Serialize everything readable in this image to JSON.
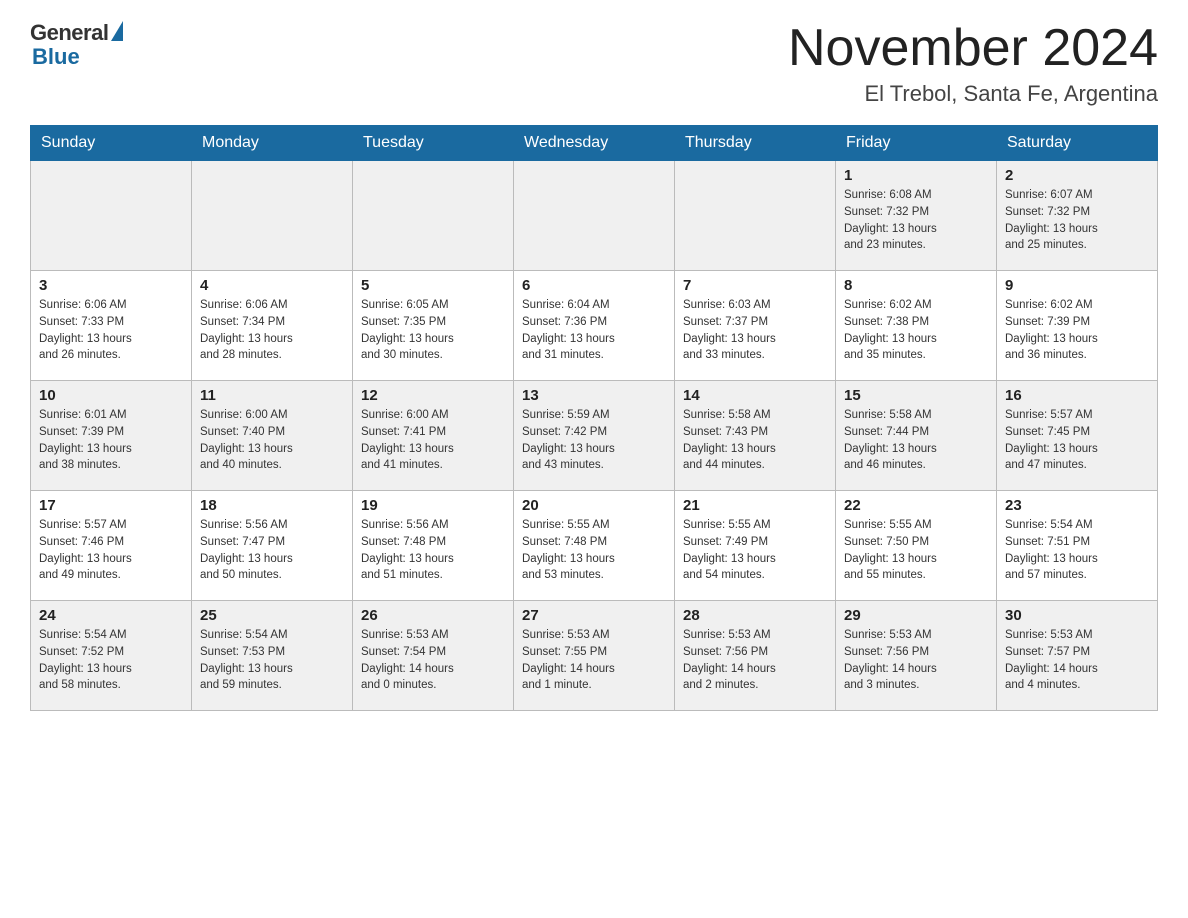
{
  "header": {
    "logo_general": "General",
    "logo_blue": "Blue",
    "month_title": "November 2024",
    "location": "El Trebol, Santa Fe, Argentina"
  },
  "weekdays": [
    "Sunday",
    "Monday",
    "Tuesday",
    "Wednesday",
    "Thursday",
    "Friday",
    "Saturday"
  ],
  "rows": [
    [
      {
        "day": "",
        "info": ""
      },
      {
        "day": "",
        "info": ""
      },
      {
        "day": "",
        "info": ""
      },
      {
        "day": "",
        "info": ""
      },
      {
        "day": "",
        "info": ""
      },
      {
        "day": "1",
        "info": "Sunrise: 6:08 AM\nSunset: 7:32 PM\nDaylight: 13 hours\nand 23 minutes."
      },
      {
        "day": "2",
        "info": "Sunrise: 6:07 AM\nSunset: 7:32 PM\nDaylight: 13 hours\nand 25 minutes."
      }
    ],
    [
      {
        "day": "3",
        "info": "Sunrise: 6:06 AM\nSunset: 7:33 PM\nDaylight: 13 hours\nand 26 minutes."
      },
      {
        "day": "4",
        "info": "Sunrise: 6:06 AM\nSunset: 7:34 PM\nDaylight: 13 hours\nand 28 minutes."
      },
      {
        "day": "5",
        "info": "Sunrise: 6:05 AM\nSunset: 7:35 PM\nDaylight: 13 hours\nand 30 minutes."
      },
      {
        "day": "6",
        "info": "Sunrise: 6:04 AM\nSunset: 7:36 PM\nDaylight: 13 hours\nand 31 minutes."
      },
      {
        "day": "7",
        "info": "Sunrise: 6:03 AM\nSunset: 7:37 PM\nDaylight: 13 hours\nand 33 minutes."
      },
      {
        "day": "8",
        "info": "Sunrise: 6:02 AM\nSunset: 7:38 PM\nDaylight: 13 hours\nand 35 minutes."
      },
      {
        "day": "9",
        "info": "Sunrise: 6:02 AM\nSunset: 7:39 PM\nDaylight: 13 hours\nand 36 minutes."
      }
    ],
    [
      {
        "day": "10",
        "info": "Sunrise: 6:01 AM\nSunset: 7:39 PM\nDaylight: 13 hours\nand 38 minutes."
      },
      {
        "day": "11",
        "info": "Sunrise: 6:00 AM\nSunset: 7:40 PM\nDaylight: 13 hours\nand 40 minutes."
      },
      {
        "day": "12",
        "info": "Sunrise: 6:00 AM\nSunset: 7:41 PM\nDaylight: 13 hours\nand 41 minutes."
      },
      {
        "day": "13",
        "info": "Sunrise: 5:59 AM\nSunset: 7:42 PM\nDaylight: 13 hours\nand 43 minutes."
      },
      {
        "day": "14",
        "info": "Sunrise: 5:58 AM\nSunset: 7:43 PM\nDaylight: 13 hours\nand 44 minutes."
      },
      {
        "day": "15",
        "info": "Sunrise: 5:58 AM\nSunset: 7:44 PM\nDaylight: 13 hours\nand 46 minutes."
      },
      {
        "day": "16",
        "info": "Sunrise: 5:57 AM\nSunset: 7:45 PM\nDaylight: 13 hours\nand 47 minutes."
      }
    ],
    [
      {
        "day": "17",
        "info": "Sunrise: 5:57 AM\nSunset: 7:46 PM\nDaylight: 13 hours\nand 49 minutes."
      },
      {
        "day": "18",
        "info": "Sunrise: 5:56 AM\nSunset: 7:47 PM\nDaylight: 13 hours\nand 50 minutes."
      },
      {
        "day": "19",
        "info": "Sunrise: 5:56 AM\nSunset: 7:48 PM\nDaylight: 13 hours\nand 51 minutes."
      },
      {
        "day": "20",
        "info": "Sunrise: 5:55 AM\nSunset: 7:48 PM\nDaylight: 13 hours\nand 53 minutes."
      },
      {
        "day": "21",
        "info": "Sunrise: 5:55 AM\nSunset: 7:49 PM\nDaylight: 13 hours\nand 54 minutes."
      },
      {
        "day": "22",
        "info": "Sunrise: 5:55 AM\nSunset: 7:50 PM\nDaylight: 13 hours\nand 55 minutes."
      },
      {
        "day": "23",
        "info": "Sunrise: 5:54 AM\nSunset: 7:51 PM\nDaylight: 13 hours\nand 57 minutes."
      }
    ],
    [
      {
        "day": "24",
        "info": "Sunrise: 5:54 AM\nSunset: 7:52 PM\nDaylight: 13 hours\nand 58 minutes."
      },
      {
        "day": "25",
        "info": "Sunrise: 5:54 AM\nSunset: 7:53 PM\nDaylight: 13 hours\nand 59 minutes."
      },
      {
        "day": "26",
        "info": "Sunrise: 5:53 AM\nSunset: 7:54 PM\nDaylight: 14 hours\nand 0 minutes."
      },
      {
        "day": "27",
        "info": "Sunrise: 5:53 AM\nSunset: 7:55 PM\nDaylight: 14 hours\nand 1 minute."
      },
      {
        "day": "28",
        "info": "Sunrise: 5:53 AM\nSunset: 7:56 PM\nDaylight: 14 hours\nand 2 minutes."
      },
      {
        "day": "29",
        "info": "Sunrise: 5:53 AM\nSunset: 7:56 PM\nDaylight: 14 hours\nand 3 minutes."
      },
      {
        "day": "30",
        "info": "Sunrise: 5:53 AM\nSunset: 7:57 PM\nDaylight: 14 hours\nand 4 minutes."
      }
    ]
  ]
}
